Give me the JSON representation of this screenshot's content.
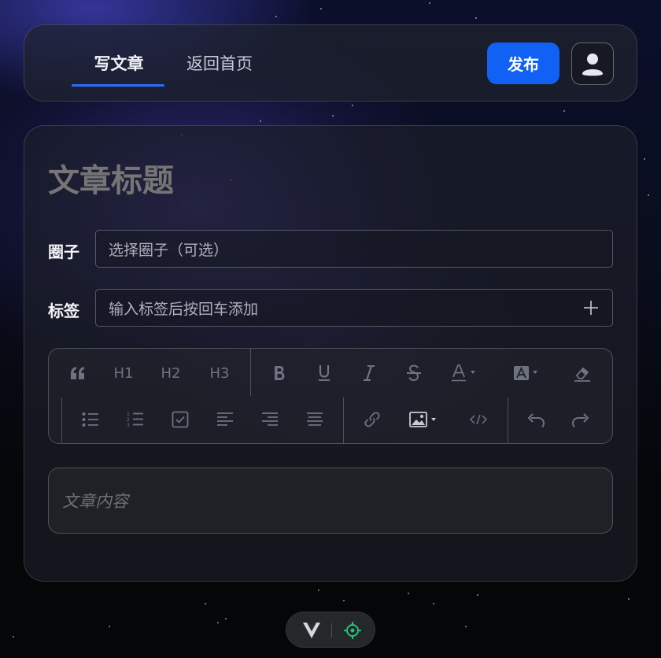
{
  "nav": {
    "write_tab": "写文章",
    "home_tab": "返回首页",
    "publish_label": "发布"
  },
  "editor": {
    "title_placeholder": "文章标题",
    "circle_label": "圈子",
    "circle_placeholder": "选择圈子（可选）",
    "tags_label": "标签",
    "tags_placeholder": "输入标签后按回车添加",
    "content_placeholder": "文章内容"
  },
  "toolbar": {
    "h1": "H1",
    "h2": "H2",
    "h3": "H3"
  },
  "colors": {
    "accent": "#1261f5",
    "tab_underline": "#2f6bff",
    "devtool_green": "#21c27a"
  }
}
